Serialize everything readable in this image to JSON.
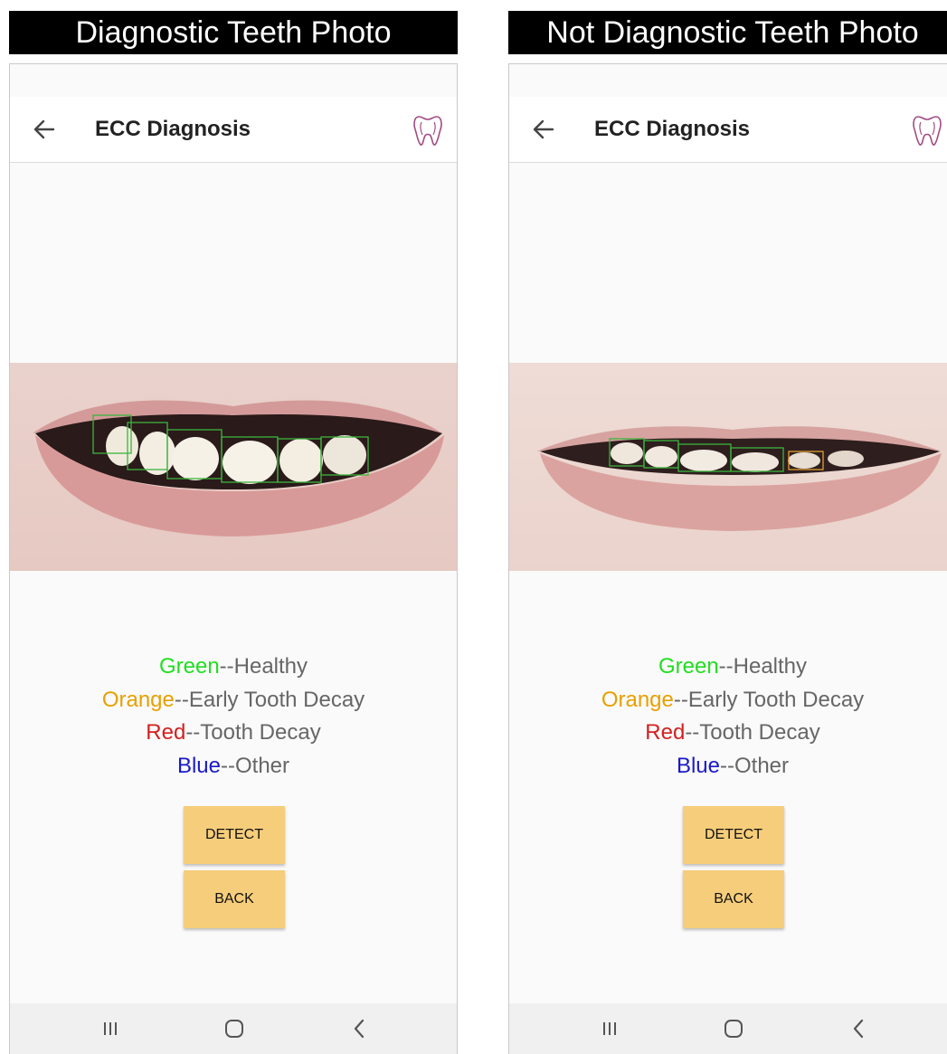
{
  "panels": [
    {
      "title": "Diagnostic Teeth Photo",
      "app_title": "ECC Diagnosis",
      "icons": {
        "back": "back-arrow-icon",
        "logo": "tooth-logo-icon"
      },
      "legend": [
        {
          "color_label": "Green",
          "desc": "--Healthy",
          "color": "#22dd22"
        },
        {
          "color_label": "Orange",
          "desc": "--Early Tooth Decay",
          "color": "#e8a000"
        },
        {
          "color_label": "Red",
          "desc": "--Tooth Decay",
          "color": "#d42020"
        },
        {
          "color_label": "Blue",
          "desc": "--Other",
          "color": "#1a1ac8"
        }
      ],
      "detect_label": "DETECT",
      "back_label": "BACK"
    },
    {
      "title": "Not Diagnostic Teeth Photo",
      "app_title": "ECC Diagnosis",
      "icons": {
        "back": "back-arrow-icon",
        "logo": "tooth-logo-icon"
      },
      "legend": [
        {
          "color_label": "Green",
          "desc": "--Healthy",
          "color": "#22dd22"
        },
        {
          "color_label": "Orange",
          "desc": "--Early Tooth Decay",
          "color": "#e8a000"
        },
        {
          "color_label": "Red",
          "desc": "--Tooth Decay",
          "color": "#d42020"
        },
        {
          "color_label": "Blue",
          "desc": "--Other",
          "color": "#1a1ac8"
        }
      ],
      "detect_label": "DETECT",
      "back_label": "BACK"
    }
  ],
  "nav_icons": [
    "recents-icon",
    "home-icon",
    "nav-back-icon"
  ],
  "detection_colors": {
    "healthy": "#3cb43c",
    "early_decay": "#e0a030"
  }
}
